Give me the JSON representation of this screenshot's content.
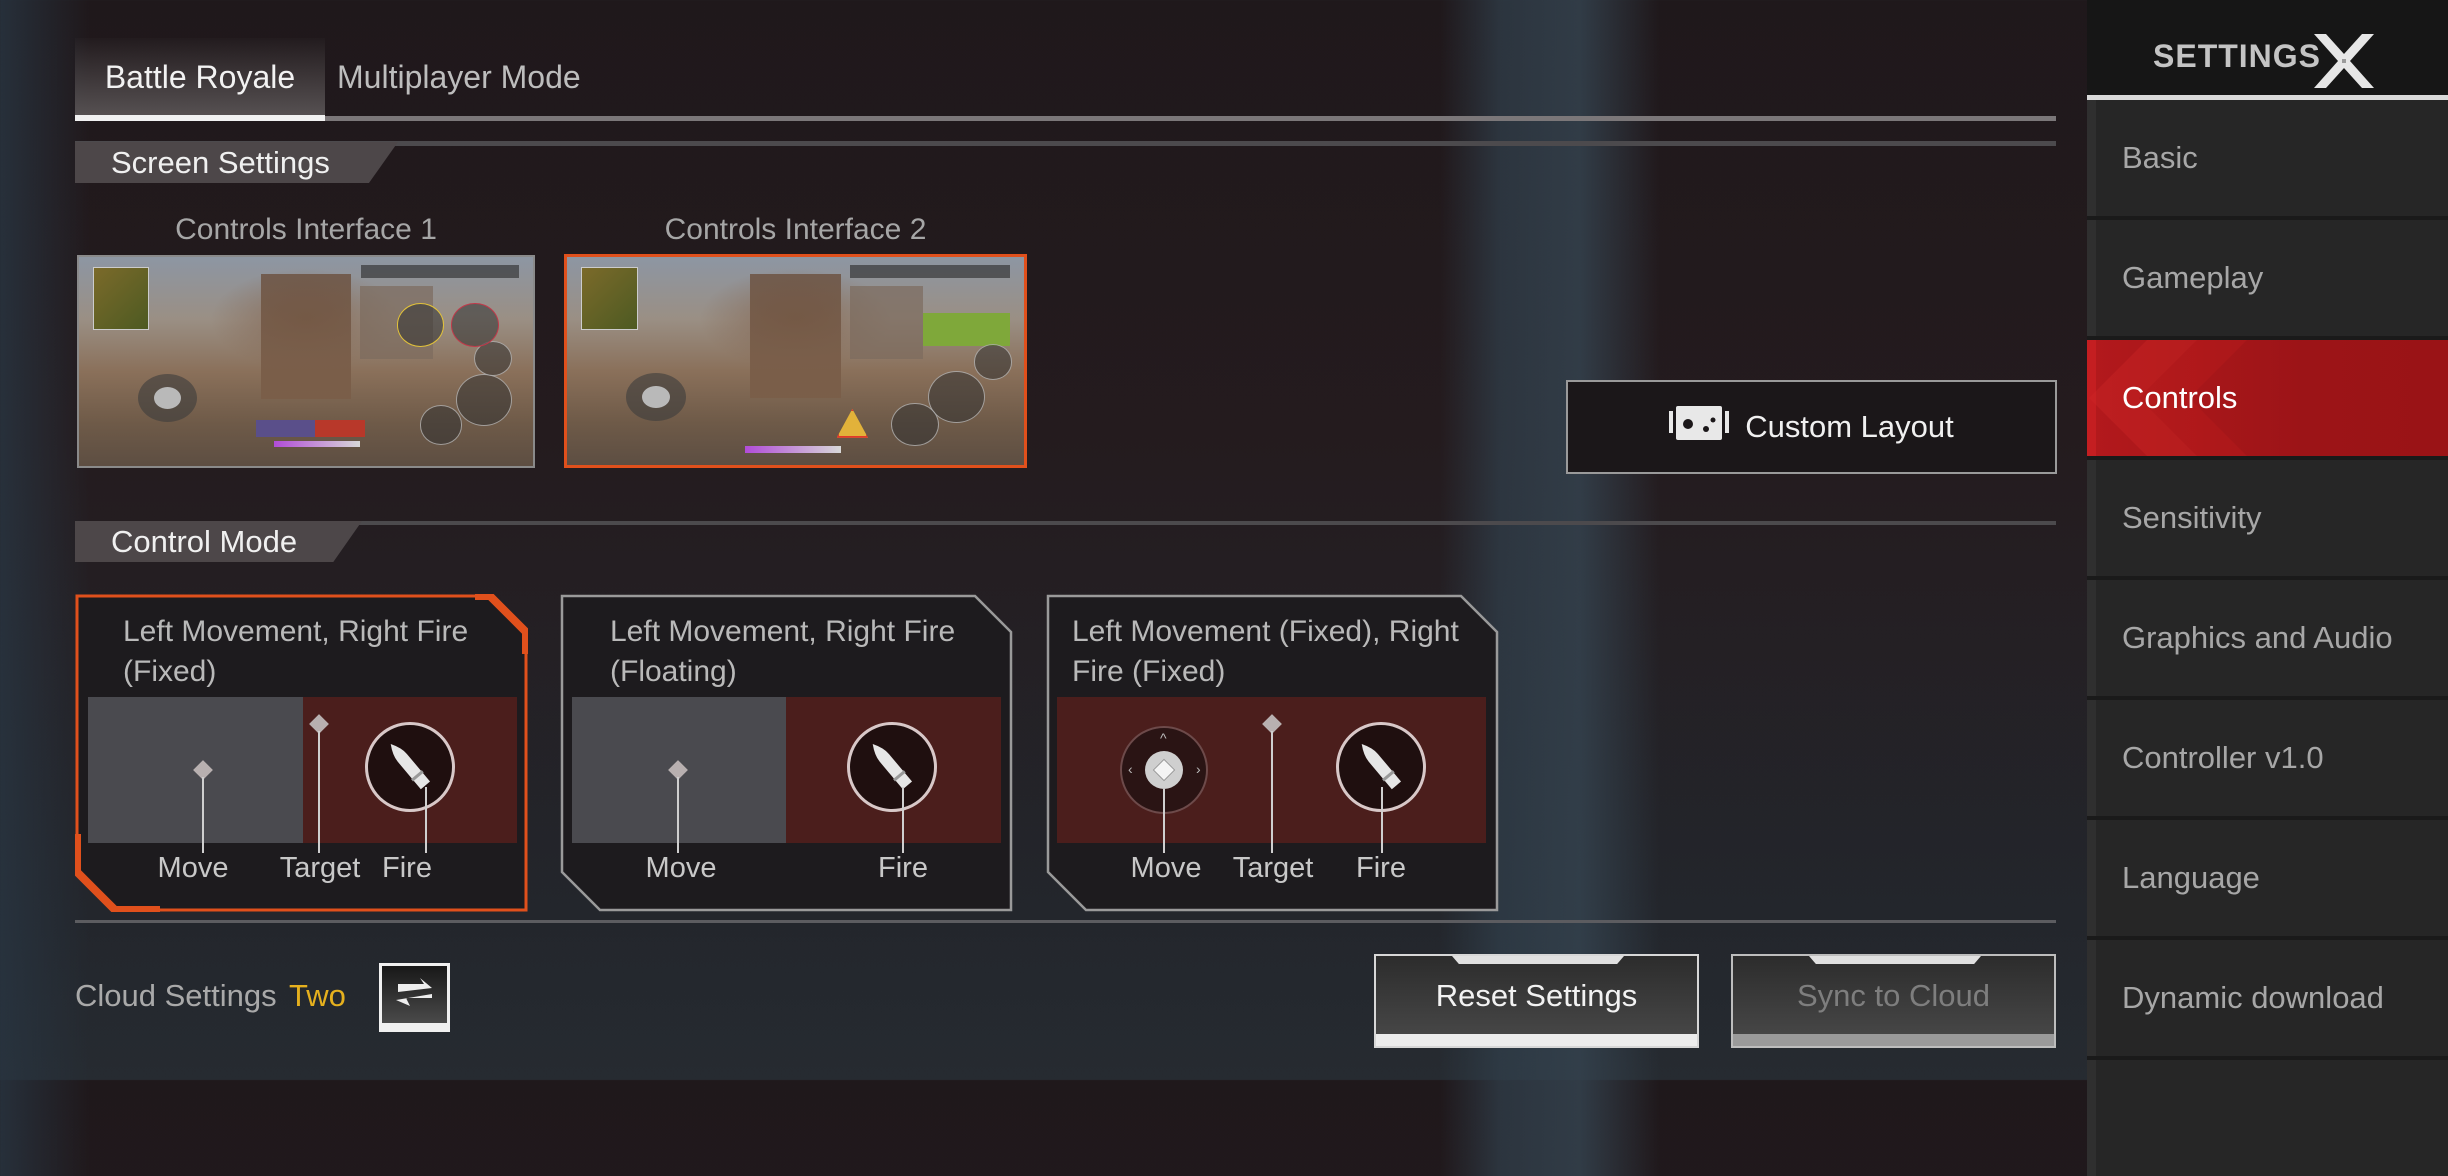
{
  "tabs": [
    {
      "label": "Battle Royale",
      "active": true
    },
    {
      "label": "Multiplayer Mode",
      "active": false
    }
  ],
  "screen_settings": {
    "header": "Screen Settings",
    "interfaces": [
      {
        "label": "Controls Interface 1",
        "selected": false
      },
      {
        "label": "Controls Interface 2",
        "selected": true
      }
    ],
    "custom_layout_label": "Custom Layout",
    "custom_layout_icon": "gamepad-layout-icon"
  },
  "control_mode": {
    "header": "Control Mode",
    "options": [
      {
        "title": "Left Movement, Right Fire (Fixed)",
        "selected": true,
        "labels": {
          "move": "Move",
          "target": "Target",
          "fire": "Fire"
        }
      },
      {
        "title": "Left Movement, Right Fire (Floating)",
        "selected": false,
        "labels": {
          "move": "Move",
          "fire": "Fire"
        }
      },
      {
        "title": "Left Movement (Fixed), Right Fire (Fixed)",
        "selected": false,
        "labels": {
          "move": "Move",
          "target": "Target",
          "fire": "Fire"
        }
      }
    ]
  },
  "cloud": {
    "label": "Cloud Settings",
    "value": "Two",
    "swap_icon": "swap-arrows-icon"
  },
  "buttons": {
    "reset": "Reset Settings",
    "sync": "Sync to Cloud"
  },
  "sidebar": {
    "title": "SETTINGS",
    "close_icon": "close-x-icon",
    "items": [
      {
        "label": "Basic",
        "active": false
      },
      {
        "label": "Gameplay",
        "active": false
      },
      {
        "label": "Controls",
        "active": true
      },
      {
        "label": "Sensitivity",
        "active": false
      },
      {
        "label": "Graphics and Audio",
        "active": false
      },
      {
        "label": "Controller v1.0",
        "active": false
      },
      {
        "label": "Language",
        "active": false
      },
      {
        "label": "Dynamic download",
        "active": false
      },
      {
        "label": "",
        "active": false
      }
    ]
  },
  "colors": {
    "accent_orange": "#e0501c",
    "active_red": "#a8171a",
    "cloud_value": "#e5b01e"
  }
}
